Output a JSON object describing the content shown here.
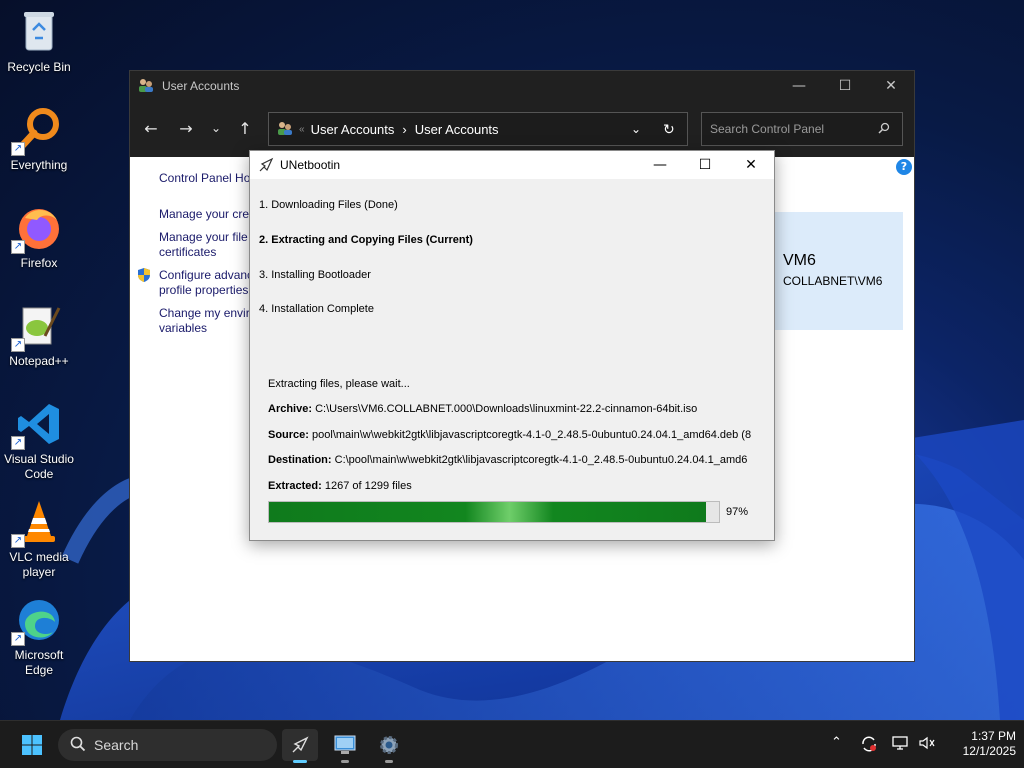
{
  "desktop": {
    "icons": [
      {
        "label": "Recycle Bin"
      },
      {
        "label": "Everything"
      },
      {
        "label": "Firefox"
      },
      {
        "label": "Notepad++"
      },
      {
        "label": "Visual Studio Code"
      },
      {
        "label": "VLC media player"
      },
      {
        "label": "Microsoft Edge"
      }
    ]
  },
  "control_panel": {
    "title": "User Accounts",
    "breadcrumb": [
      "User Accounts",
      "User Accounts"
    ],
    "search_placeholder": "Search Control Panel",
    "sidebar": {
      "home": "Control Panel Ho",
      "link1": "Manage your cre",
      "link2a": "Manage your file",
      "link2b": "certificates",
      "link3a": "Configure advanc",
      "link3b": "profile properties",
      "link4a": "Change my envir",
      "link4b": "variables"
    },
    "user": {
      "name": "VM6",
      "account": "COLLABNET\\VM6"
    }
  },
  "unetbootin": {
    "title": "UNetbootin",
    "steps": [
      "1. Downloading Files (Done)",
      "2. Extracting and Copying Files (Current)",
      "3. Installing Bootloader",
      "4. Installation Complete"
    ],
    "status": "Extracting files, please wait...",
    "archive_label": "Archive:",
    "archive_value": "C:\\Users\\VM6.COLLABNET.000\\Downloads\\linuxmint-22.2-cinnamon-64bit.iso",
    "source_label": "Source:",
    "source_value": "pool\\main\\w\\webkit2gtk\\libjavascriptcoregtk-4.1-0_2.48.5-0ubuntu0.24.04.1_amd64.deb (8",
    "destination_label": "Destination:",
    "destination_value": "C:\\pool\\main\\w\\webkit2gtk\\libjavascriptcoregtk-4.1-0_2.48.5-0ubuntu0.24.04.1_amd6",
    "extracted_label": "Extracted:",
    "extracted_value": "1267 of 1299 files",
    "progress_fraction": 0.97,
    "progress_text": "97%"
  },
  "taskbar": {
    "search_label": "Search",
    "time": "1:37 PM",
    "date": "12/1/2025"
  },
  "colors": {
    "progress": "#12861f",
    "titlebar_dark": "#202020",
    "taskbar": "#1c1c1c"
  }
}
